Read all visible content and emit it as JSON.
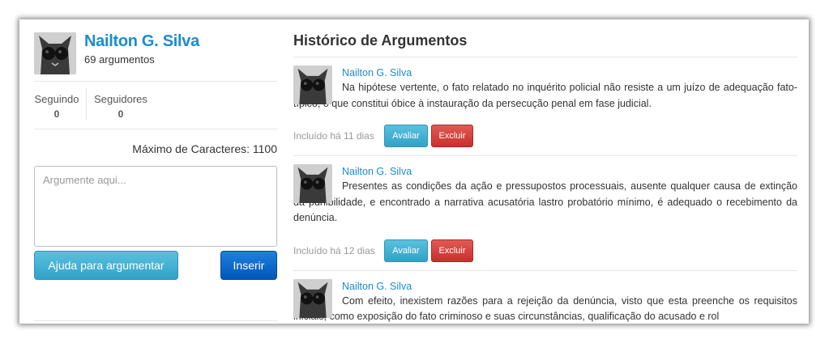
{
  "profile": {
    "name": "Nailton G. Silva",
    "count": "69 argumentos"
  },
  "stats": {
    "following_label": "Seguindo",
    "following_value": "0",
    "followers_label": "Seguidores",
    "followers_value": "0"
  },
  "composer": {
    "max_chars": "Máximo de Caracteres: 1100",
    "placeholder": "Argumente aqui...",
    "help_label": "Ajuda para argumentar",
    "insert_label": "Inserir"
  },
  "history": {
    "title": "Histórico de Argumentos",
    "items": [
      {
        "author": "Nailton G. Silva",
        "text": "Na hipótese vertente, o fato relatado no inquérito policial não resiste a um juízo de adequação fato-típico, o que constitui óbice à instauração da persecução penal em fase judicial.",
        "included": "Incluído há 11 dias",
        "evaluate": "Avaliar",
        "delete": "Excluir"
      },
      {
        "author": "Nailton G. Silva",
        "text": "Presentes as condições da ação e pressupostos processuais, ausente qualquer causa de extinção da punibilidade, e encontrado a narrativa acusatória lastro probatório mínimo, é adequado o recebimento da denúncia.",
        "included": "Incluído há 12 dias",
        "evaluate": "Avaliar",
        "delete": "Excluir"
      },
      {
        "author": "Nailton G. Silva",
        "text": "Com efeito, inexistem razões para a rejeição da denúncia, visto que esta preenche os requisitos iniciais, como exposição do fato criminoso e suas circunstâncias, qualificação do acusado e rol",
        "included": "",
        "evaluate": "",
        "delete": ""
      }
    ]
  },
  "colors": {
    "accent": "#1a8ccf",
    "info": "#5bc0de",
    "danger": "#d9534f",
    "primary": "#0a6fd6"
  },
  "icons": {
    "avatar": "cat-with-sunglasses-avatar"
  }
}
